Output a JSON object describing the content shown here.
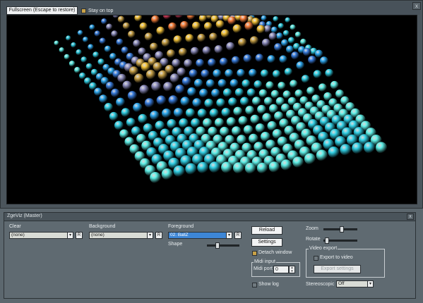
{
  "top_window": {
    "fullscreen_button": "Fullscreen (Escape to restore)",
    "stay_on_top_label": "Stay on top",
    "stay_on_top_checked": true,
    "close_glyph": "x"
  },
  "panel": {
    "title": "ZgeViz (Master)",
    "close_glyph": "x",
    "clear": {
      "label": "Clear",
      "value": "(none)",
      "r_label": "R"
    },
    "background": {
      "label": "Background",
      "value": "(none)",
      "r_label": "R"
    },
    "foreground": {
      "label": "Foreground",
      "value": "02. BallZ",
      "r_label": "R"
    },
    "shape_label": "Shape",
    "shape_value": 0.3,
    "reload_button": "Reload",
    "settings_button": "Settings",
    "detach_window_label": "Detach window",
    "detach_window_checked": true,
    "midi_input": {
      "group_label": "Midi input",
      "port_label": "Midi port",
      "port_value": "0"
    },
    "show_log_label": "Show log",
    "show_log_checked": false,
    "zoom_label": "Zoom",
    "zoom_value": 0.55,
    "rotate_label": "Rotate",
    "rotate_value": 0.05,
    "video_export": {
      "group_label": "Video export",
      "export_label": "Export to video",
      "export_checked": false,
      "export_settings_button": "Export settings"
    },
    "stereoscopic_label": "Stereoscopic",
    "stereoscopic_value": "Off"
  },
  "colors": {
    "accent": "#c9a247",
    "selection": "#3d86d6",
    "viewport_bg": "#000000"
  }
}
